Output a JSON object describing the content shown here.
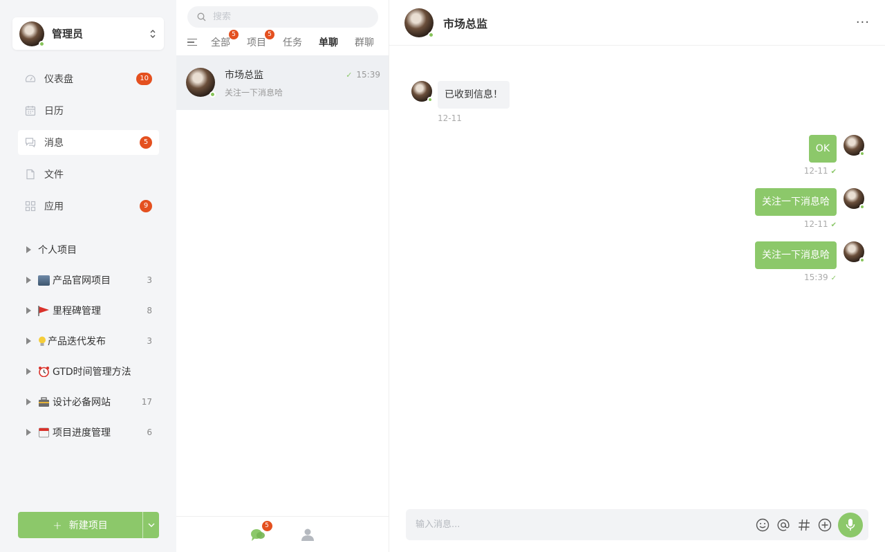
{
  "user": {
    "name": "管理员"
  },
  "nav": [
    {
      "label": "仪表盘",
      "icon": "dashboard-icon",
      "badge": "10"
    },
    {
      "label": "日历",
      "icon": "calendar-icon",
      "badge": null
    },
    {
      "label": "消息",
      "icon": "message-icon",
      "badge": "5"
    },
    {
      "label": "文件",
      "icon": "file-icon",
      "badge": null
    },
    {
      "label": "应用",
      "icon": "apps-icon",
      "badge": "9"
    }
  ],
  "projects": [
    {
      "name": "个人项目",
      "emoji": "",
      "count": ""
    },
    {
      "name": "产品官网项目",
      "emoji": "building-emoji",
      "count": "3"
    },
    {
      "name": "里程碑管理",
      "emoji": "flag-emoji",
      "count": "8"
    },
    {
      "name": "产品迭代发布",
      "emoji": "bulb-emoji",
      "count": "3"
    },
    {
      "name": "GTD时间管理方法",
      "emoji": "alarm-clock-emoji",
      "count": ""
    },
    {
      "name": "设计必备网站",
      "emoji": "toolbox-emoji",
      "count": "17"
    },
    {
      "name": "项目进度管理",
      "emoji": "calendar-emoji",
      "count": "6"
    }
  ],
  "new_project": {
    "label": "新建项目",
    "plus": "+"
  },
  "search": {
    "placeholder": "搜索"
  },
  "tabs": [
    {
      "label": "全部",
      "badge": "5"
    },
    {
      "label": "项目",
      "badge": "5"
    },
    {
      "label": "任务",
      "badge": null
    },
    {
      "label": "单聊",
      "badge": null
    },
    {
      "label": "群聊",
      "badge": null
    }
  ],
  "conversation": {
    "name": "市场总监",
    "time": "15:39",
    "preview": "关注一下消息哈",
    "check": "✓"
  },
  "footer": {
    "chat_badge": "5"
  },
  "chat": {
    "title": "市场总监",
    "more": "···",
    "messages": [
      {
        "direction": "in",
        "text": "已收到信息！",
        "time": "12-11"
      },
      {
        "direction": "out",
        "text": "OK",
        "time": "12-11"
      },
      {
        "direction": "out",
        "text": "关注一下消息哈",
        "time": "12-11"
      },
      {
        "direction": "out",
        "text": "关注一下消息哈",
        "time": "15:39"
      }
    ]
  },
  "composer": {
    "placeholder": "输入消息..."
  },
  "colors": {
    "accent": "#8cc86a",
    "badge": "#e4501f",
    "online": "#87c45b"
  }
}
